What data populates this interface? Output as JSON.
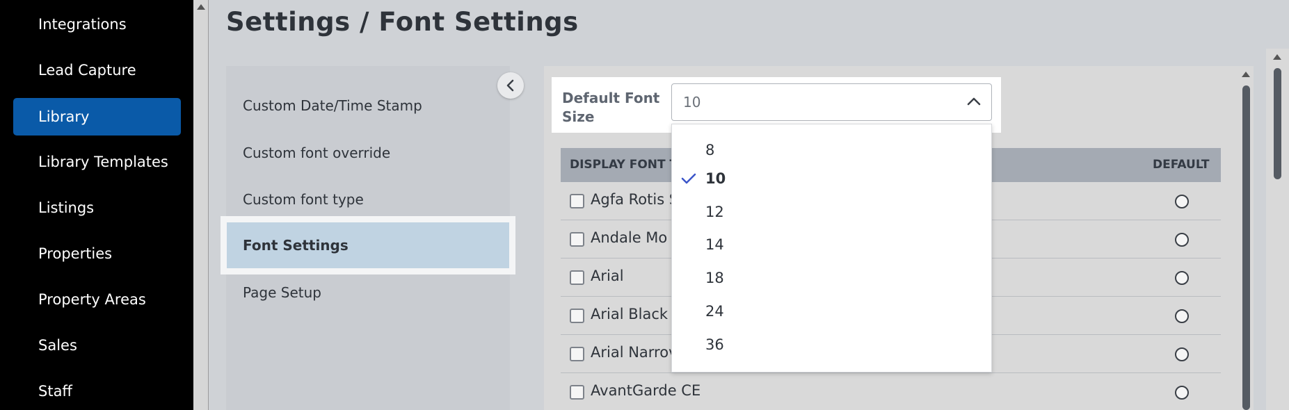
{
  "nav": {
    "items": [
      {
        "label": "Integrations"
      },
      {
        "label": "Lead Capture"
      },
      {
        "label": "Library"
      },
      {
        "label": "Library Templates"
      },
      {
        "label": "Listings"
      },
      {
        "label": "Properties"
      },
      {
        "label": "Property Areas"
      },
      {
        "label": "Sales"
      },
      {
        "label": "Staff"
      }
    ],
    "active": "Library"
  },
  "header": {
    "title": "Settings / Font Settings"
  },
  "submenu": {
    "items": [
      {
        "label": "Custom Date/Time Stamp"
      },
      {
        "label": "Custom font override"
      },
      {
        "label": "Custom font type"
      },
      {
        "label": "Font Settings"
      },
      {
        "label": "Page Setup"
      }
    ],
    "active": "Font Settings"
  },
  "font_size": {
    "label": "Default Font Size",
    "value": "10",
    "options": [
      "8",
      "10",
      "12",
      "14",
      "18",
      "24",
      "36"
    ],
    "selected": "10"
  },
  "table": {
    "headers": {
      "display": "DISPLAY FONT T",
      "default": "DEFAULT"
    },
    "rows": [
      {
        "name": "Agfa Rotis S"
      },
      {
        "name": "Andale Mo"
      },
      {
        "name": "Arial"
      },
      {
        "name": "Arial Black"
      },
      {
        "name": "Arial Narrov"
      },
      {
        "name": "AvantGarde CE"
      }
    ]
  },
  "colors": {
    "accent": "#0a5aa8",
    "check": "#3b55c9",
    "active_submenu": "#c0d3e2"
  },
  "icons": {
    "collapse": "chevron-left-icon",
    "select": "chevron-up-icon",
    "selected": "check-icon"
  }
}
